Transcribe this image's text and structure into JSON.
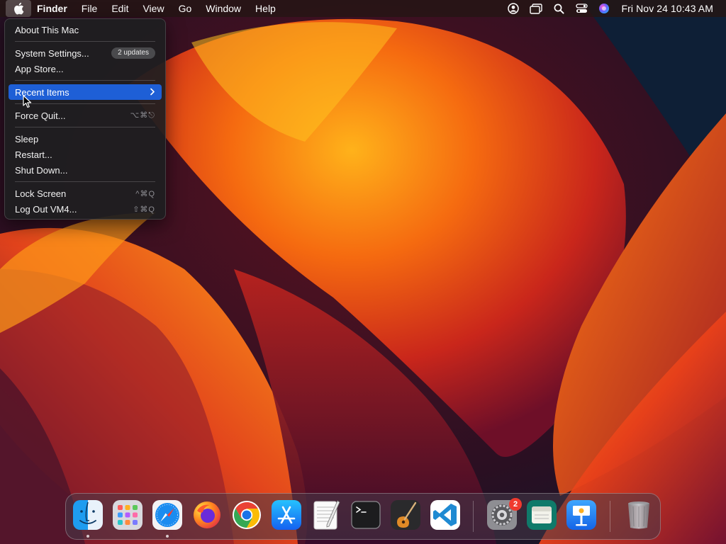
{
  "menubar": {
    "app_name": "Finder",
    "items": [
      "File",
      "Edit",
      "View",
      "Go",
      "Window",
      "Help"
    ],
    "status_icons": [
      "user-account-icon",
      "screen-mirroring-icon",
      "spotlight-search-icon",
      "control-center-icon",
      "siri-icon"
    ],
    "clock": "Fri Nov 24  10:43 AM"
  },
  "apple_menu": {
    "about": "About This Mac",
    "system_settings": "System Settings...",
    "updates_badge": "2 updates",
    "app_store": "App Store...",
    "recent_items": "Recent Items",
    "force_quit": "Force Quit...",
    "force_quit_shortcut": "⌥⌘⎋",
    "sleep": "Sleep",
    "restart": "Restart...",
    "shut_down": "Shut Down...",
    "lock_screen": "Lock Screen",
    "lock_screen_shortcut": "^⌘Q",
    "log_out": "Log Out VM4...",
    "log_out_shortcut": "⇧⌘Q"
  },
  "dock": {
    "apps": [
      "Finder",
      "Launchpad",
      "Safari",
      "Firefox",
      "Google Chrome",
      "App Store",
      "TextEdit",
      "Terminal",
      "GarageBand",
      "Visual Studio Code",
      "System Settings",
      "Archive",
      "Keynote",
      "Trash"
    ],
    "running": [
      "Finder",
      "Safari"
    ],
    "system_settings_badge": "2"
  },
  "colors": {
    "menu_highlight": "#1e5fd6",
    "badge_red": "#f03a2e"
  }
}
